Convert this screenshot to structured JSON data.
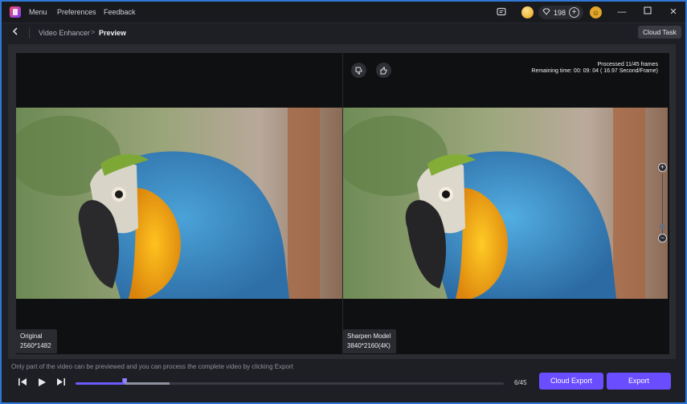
{
  "menu": {
    "items": [
      "Menu",
      "Preferences",
      "Feedback"
    ],
    "gem_count": "198"
  },
  "breadcrumb": {
    "parent": "Video Enhancer",
    "separator": ">",
    "current": "Preview",
    "cloud_task": "Cloud Task"
  },
  "viewer": {
    "processed": "Processed 11/45 frames",
    "remaining": "Remaining time: 00: 09: 04 ( 16.97 Second/Frame)",
    "left_label": "Original",
    "left_resolution": "2560*1482",
    "right_label": "Sharpen Model",
    "right_resolution": "3840*2160(4K)"
  },
  "footer": {
    "notice": "Only part of the video can be previewed and you can process the complete video by clicking Export",
    "frame_count": "6/45",
    "cloud_export": "Cloud Export",
    "export": "Export",
    "progress_fraction": 0.115,
    "buffered_fraction": 0.22
  },
  "colors": {
    "accent": "#6a4dff",
    "window_border": "#2f78d6"
  }
}
